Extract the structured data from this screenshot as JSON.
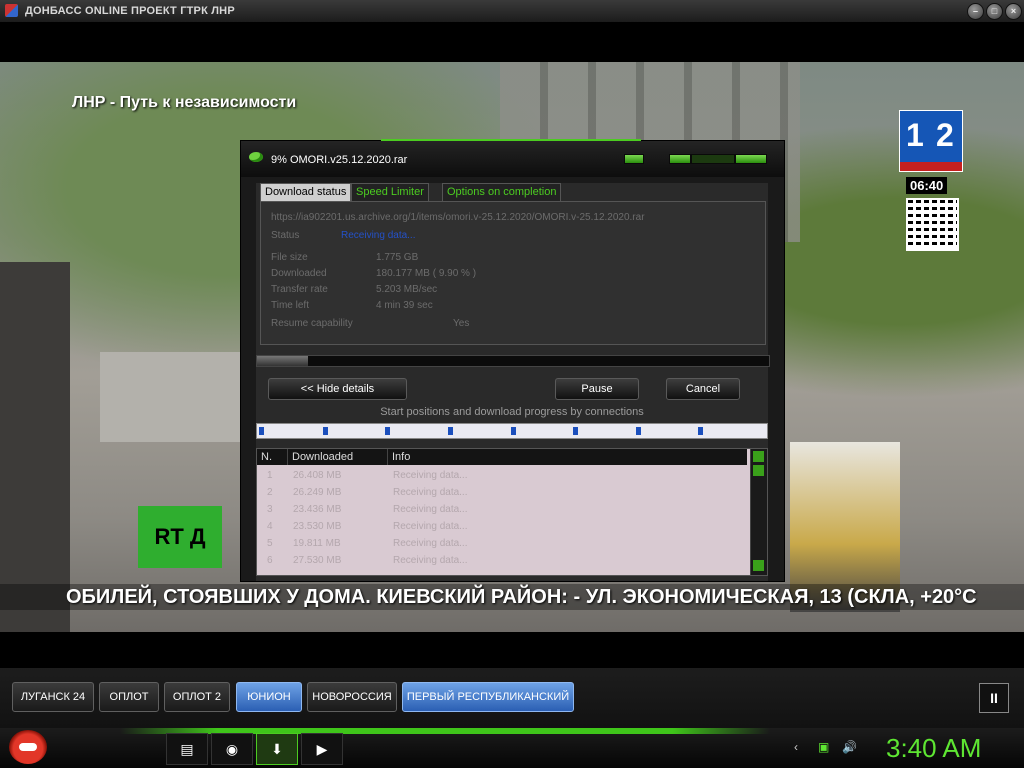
{
  "player": {
    "title": "ДОНБАСС ONLINE ПРОЕКТ ГТРК ЛНР",
    "window_buttons": [
      "minimize",
      "maximize",
      "close"
    ]
  },
  "video": {
    "overlay_title": "ЛНР - Путь к независимости",
    "channel_logo": "1 2",
    "clock": "06:40",
    "rtd_logo": "RT Д",
    "ticker": "ОБИЛЕЙ, СТОЯВШИХ У ДОМА. КИЕВСКИЙ РАЙОН: - УЛ. ЭКОНОМИЧЕСКАЯ, 13 (СКЛА, +20°C"
  },
  "download": {
    "title": "9% OMORI.v25.12.2020.rar",
    "tabs": [
      "Download status",
      "Speed Limiter",
      "Options on completion"
    ],
    "url": "https://ia902201.us.archive.org/1/items/omori.v-25.12.2020/OMORI.v-25.12.2020.rar",
    "status_label": "Status",
    "status_value": "Receiving data...",
    "fields": [
      {
        "label": "File size",
        "value": "1.775  GB"
      },
      {
        "label": "Downloaded",
        "value": "180.177  MB  ( 9.90 % )"
      },
      {
        "label": "Transfer rate",
        "value": "5.203  MB/sec"
      },
      {
        "label": "Time left",
        "value": "4 min 39 sec"
      },
      {
        "label": "Resume capability",
        "value": "Yes"
      }
    ],
    "progress": 0.099,
    "buttons": {
      "hide_details": "<< Hide details",
      "pause": "Pause",
      "cancel": "Cancel"
    },
    "connections_caption": "Start positions and download progress by connections",
    "connection_markers": [
      0.0,
      0.127,
      0.252,
      0.378,
      0.503,
      0.628,
      0.753,
      0.878
    ],
    "grid": {
      "columns": [
        "N.",
        "Downloaded",
        "Info"
      ],
      "rows": [
        {
          "n": "1",
          "downloaded": "26.408  MB",
          "info": "Receiving data..."
        },
        {
          "n": "2",
          "downloaded": "26.249  MB",
          "info": "Receiving data..."
        },
        {
          "n": "3",
          "downloaded": "23.436  MB",
          "info": "Receiving data..."
        },
        {
          "n": "4",
          "downloaded": "23.530  MB",
          "info": "Receiving data..."
        },
        {
          "n": "5",
          "downloaded": "19.811  MB",
          "info": "Receiving data..."
        },
        {
          "n": "6",
          "downloaded": "27.530  MB",
          "info": "Receiving data..."
        }
      ]
    }
  },
  "channels": [
    {
      "label": "ЛУГАНСК 24",
      "active": false
    },
    {
      "label": "ОПЛОТ",
      "active": false
    },
    {
      "label": "ОПЛОТ 2",
      "active": false
    },
    {
      "label": "ЮНИОН",
      "active": true
    },
    {
      "label": "НОВОРОССИЯ",
      "active": false
    },
    {
      "label": "ПЕРВЫЙ РЕСПУБЛИКАНСКИЙ",
      "active": true
    }
  ],
  "taskbar": {
    "clock": "3:40 AM",
    "icons": [
      "folder-icon",
      "chrome-icon",
      "download-manager-icon",
      "visual-studio-icon"
    ]
  }
}
